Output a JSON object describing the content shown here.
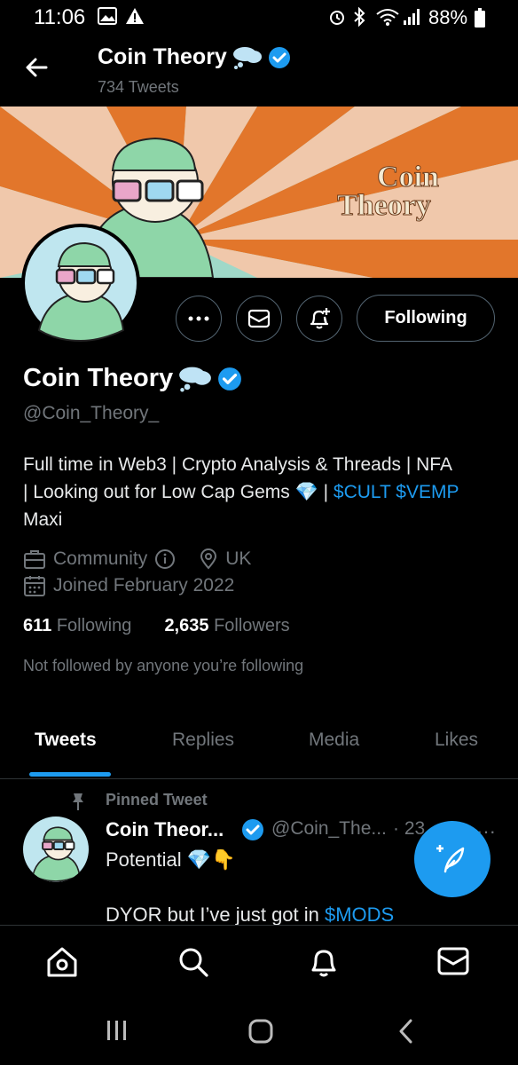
{
  "status_bar": {
    "time": "11:06",
    "battery": "88%"
  },
  "header": {
    "title": "Coin Theory",
    "tweet_count": "734 Tweets"
  },
  "banner": {
    "text_line1": "Coin",
    "text_line2": "Theory"
  },
  "profile": {
    "name": "Coin Theory",
    "handle": "@Coin_Theory_",
    "following_button": "Following",
    "bio_line1": "Full time in Web3 | Crypto Analysis & Threads | NFA",
    "bio_line2_a": "| Looking out for Low Cap Gems 💎 | ",
    "bio_line2_link": "$CULT $VEMP",
    "bio_line3": "Maxi",
    "category": "Community",
    "location": "UK",
    "joined": "Joined February 2022",
    "following_count": "611",
    "following_label": "Following",
    "followers_count": "2,635",
    "followers_label": "Followers",
    "not_followed": "Not followed by anyone you’re following"
  },
  "tabs": [
    {
      "label": "Tweets"
    },
    {
      "label": "Replies"
    },
    {
      "label": "Media"
    },
    {
      "label": "Likes"
    }
  ],
  "tweet": {
    "pinned_label": "Pinned Tweet",
    "name": "Coin Theor...",
    "handle": "@Coin_The...",
    "time": "· 23",
    "text_line1": "Potential 💎👇",
    "text_line2_a": "DYOR but I’ve just got in ",
    "text_line2_link": "$MODS"
  },
  "colors": {
    "accent": "#1d9bf0",
    "background": "#000000",
    "muted": "#71767b"
  },
  "icons": {
    "back": "arrow-left-icon",
    "more": "more-icon",
    "message": "mail-icon",
    "notify": "bell-plus-icon",
    "compose": "compose-icon",
    "home": "home-icon",
    "search": "search-icon",
    "notifications": "bell-icon",
    "messages": "mail-icon"
  }
}
